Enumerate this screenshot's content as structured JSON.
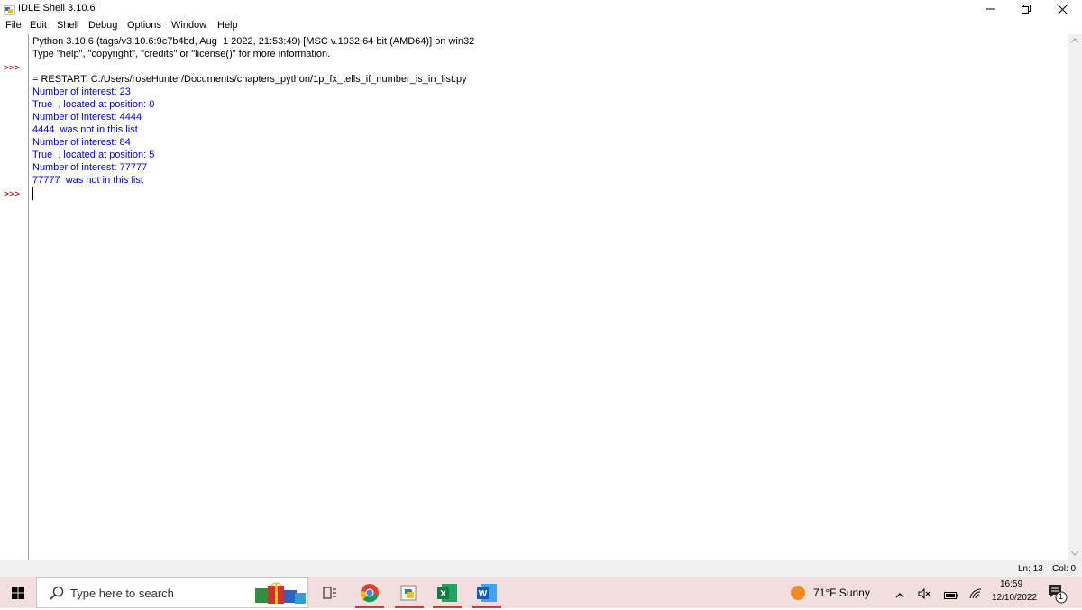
{
  "window": {
    "title": "IDLE Shell 3.10.6",
    "icon": "python-idle-icon",
    "controls": [
      "minimize-icon",
      "restore-icon",
      "close-icon"
    ]
  },
  "menubar": {
    "items": [
      "File",
      "Edit",
      "Shell",
      "Debug",
      "Options",
      "Window",
      "Help"
    ]
  },
  "shell": {
    "prompt": ">>>",
    "lines": [
      {
        "text": "Python 3.10.6 (tags/v3.10.6:9c7b4bd, Aug  1 2022, 21:53:49) [MSC v.1932 64 bit (AMD64)] on win32",
        "color": "black"
      },
      {
        "text": "Type \"help\", \"copyright\", \"credits\" or \"license()\" for more information.",
        "color": "black"
      },
      {
        "text": "",
        "color": "black"
      },
      {
        "text": "= RESTART: C:/Users/roseHunter/Documents/chapters_python/1p_fx_tells_if_number_is_in_list.py",
        "color": "black"
      },
      {
        "text": "Number of interest: 23",
        "color": "blue"
      },
      {
        "text": "True  , located at position: 0",
        "color": "blue"
      },
      {
        "text": "Number of interest: 4444",
        "color": "blue"
      },
      {
        "text": "4444  was not in this list",
        "color": "blue"
      },
      {
        "text": "Number of interest: 84",
        "color": "blue"
      },
      {
        "text": "True  , located at position: 5",
        "color": "blue"
      },
      {
        "text": "Number of interest: 77777",
        "color": "blue"
      },
      {
        "text": "77777  was not in this list",
        "color": "blue"
      }
    ]
  },
  "statusbar": {
    "line": "Ln: 13",
    "col": "Col: 0"
  },
  "taskbar": {
    "search_placeholder": "Type here to search",
    "apps": [
      "gift-boxes-icon",
      "task-view-icon",
      "chrome-icon",
      "python-icon",
      "excel-icon",
      "word-icon"
    ],
    "weather": "71°F  Sunny",
    "time": "16:59",
    "date": "12/10/2022",
    "notification_count": "1"
  },
  "colors": {
    "prompt": "#8b0000",
    "output_blue": "#0000d8",
    "taskbar_bg": "#f3dede"
  }
}
